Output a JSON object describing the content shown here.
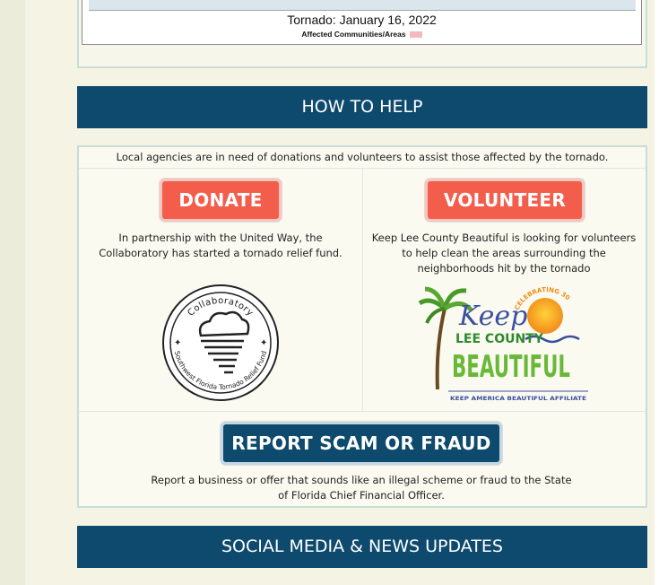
{
  "map": {
    "caption": "Tornado: January 16, 2022",
    "legend_label": "Affected Communities/Areas",
    "legend_color": "#f4b8bd"
  },
  "how_to_help": {
    "heading": "HOW TO HELP",
    "intro": "Local agencies are in need of donations and volunteers to assist those affected by the tornado.",
    "donate": {
      "button_label": "DONATE",
      "description": "In partnership with the United Way, the Collaboratory has started a tornado relief fund.",
      "logo_text_top": "Collaboratory",
      "logo_text_bottom": "Southwest Florida Tornado Relief Fund"
    },
    "volunteer": {
      "button_label": "VOLUNTEER",
      "description": "Keep Lee County Beautiful is looking for volunteers to help clean the areas surrounding the neighborhoods hit by the tornado",
      "logo_text": {
        "keep": "Keep",
        "lee_county": "LEE COUNTY",
        "beautiful": "BEAUTIFUL",
        "celebrating": "CELEBRATING 30 YEARS",
        "affiliate": "KEEP AMERICA BEAUTIFUL AFFILIATE"
      }
    },
    "report": {
      "button_label": "REPORT SCAM OR FRAUD",
      "description": "Report a business or offer that sounds like an illegal scheme or fraud to the State of Florida Chief Financial Officer."
    }
  },
  "social": {
    "heading": "SOCIAL MEDIA & NEWS UPDATES"
  },
  "colors": {
    "accent_blue": "#0e4a6e",
    "cta_orange": "#f35d4c",
    "page_bg": "#f5f4e4"
  }
}
